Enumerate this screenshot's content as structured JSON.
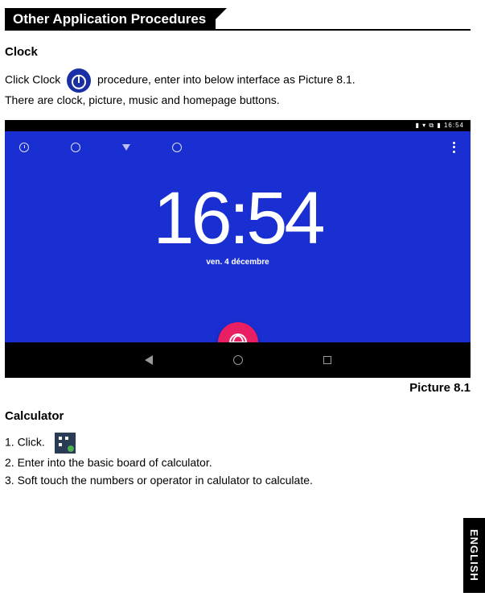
{
  "header": {
    "title": "Other Application Procedures"
  },
  "clock": {
    "heading": "Clock",
    "text_before": "Click Clock",
    "text_after": "procedure, enter into below interface as Picture 8.1.",
    "text_line2": "There are clock, picture, music and homepage buttons."
  },
  "screenshot": {
    "status_text": "▮ ▾ ⧉ ▮ 16:54",
    "time": "16:54",
    "date": "ven. 4 décembre",
    "caption": "Picture 8.1"
  },
  "calculator": {
    "heading": "Calculator",
    "steps": [
      "1. Click.",
      "2. Enter into the basic board of calculator.",
      "3. Soft touch the numbers or operator in calulator to calculate."
    ]
  },
  "language_tab": "ENGLISH"
}
